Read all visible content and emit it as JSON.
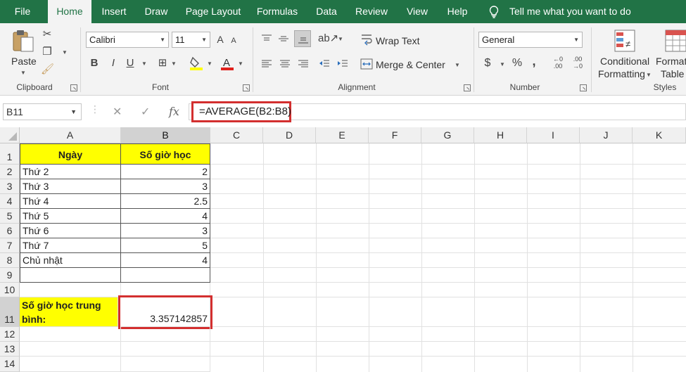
{
  "menu": {
    "tabs": [
      "File",
      "Home",
      "Insert",
      "Draw",
      "Page Layout",
      "Formulas",
      "Data",
      "Review",
      "View",
      "Help"
    ],
    "active_tab": "Home",
    "tell_me": "Tell me what you want to do"
  },
  "ribbon": {
    "clipboard": {
      "paste_label": "Paste",
      "group_label": "Clipboard"
    },
    "font": {
      "font_name": "Calibri",
      "font_size": "11",
      "bold": "B",
      "italic": "I",
      "underline": "U",
      "group_label": "Font"
    },
    "alignment": {
      "wrap_text": "Wrap Text",
      "merge_center": "Merge & Center",
      "group_label": "Alignment"
    },
    "number": {
      "format": "General",
      "currency": "$",
      "percent": "%",
      "comma": ",",
      "group_label": "Number"
    },
    "styles": {
      "conditional_1": "Conditional",
      "conditional_2": "Formatting",
      "format_table_1": "Format",
      "format_table_2": "Table",
      "group_label": "Styles"
    }
  },
  "formula_bar": {
    "name_box": "B11",
    "formula": "=AVERAGE(B2:B8)",
    "fx": "fx"
  },
  "sheet": {
    "columns": [
      "A",
      "B",
      "C",
      "D",
      "E",
      "F",
      "G",
      "H",
      "I",
      "J",
      "K"
    ],
    "rows": [
      "1",
      "2",
      "3",
      "4",
      "5",
      "6",
      "7",
      "8",
      "9",
      "10",
      "11",
      "12",
      "13",
      "14"
    ],
    "header_day": "Ngày",
    "header_hours": "Số giờ học",
    "days": [
      "Thứ 2",
      "Thứ 3",
      "Thứ 4",
      "Thứ 5",
      "Thứ 6",
      "Thứ 7",
      "Chủ nhật"
    ],
    "hours": [
      "2",
      "3",
      "2.5",
      "4",
      "3",
      "5",
      "4"
    ],
    "avg_label_line1": "Số giờ học trung",
    "avg_label_line2": "bình:",
    "avg_value": "3.357142857"
  }
}
